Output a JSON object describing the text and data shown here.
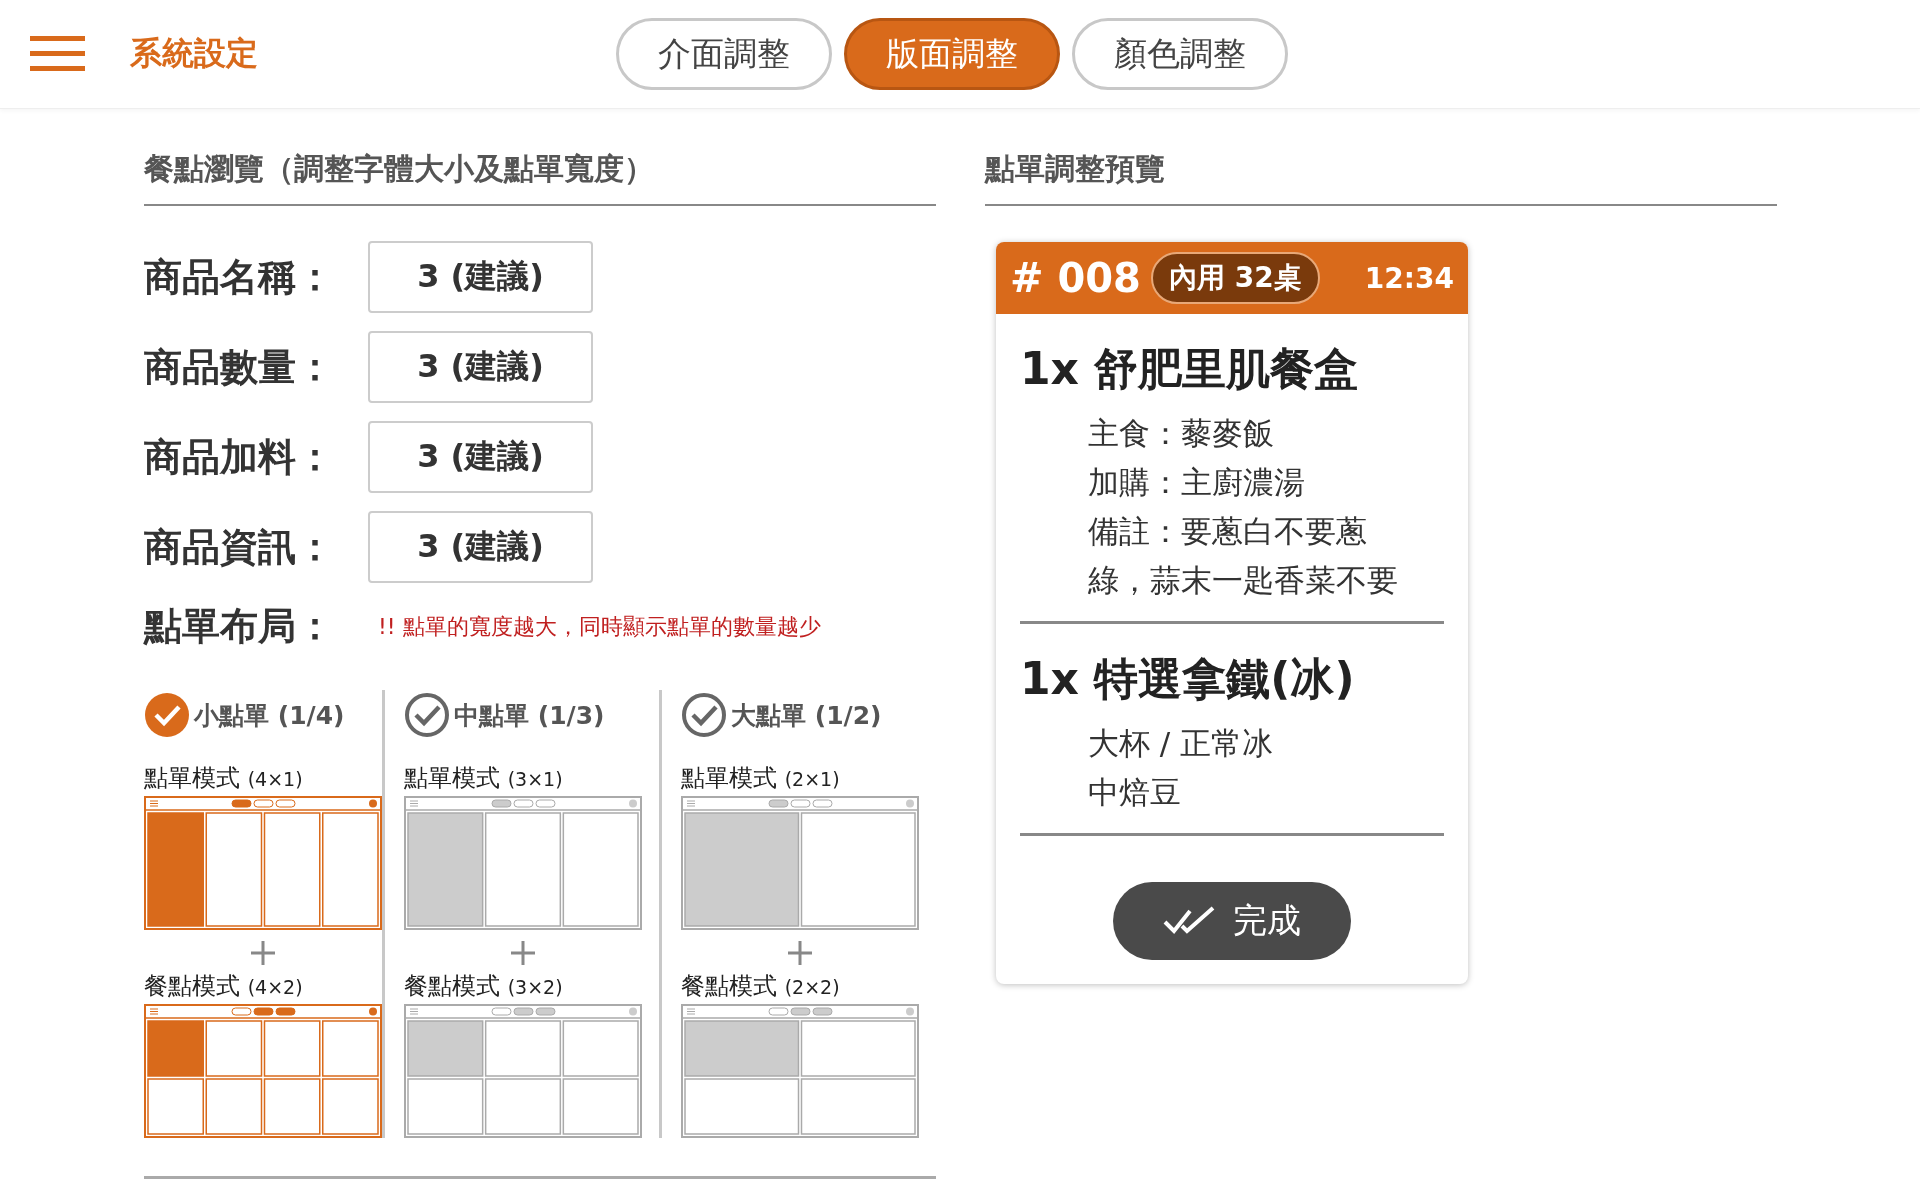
{
  "header": {
    "title": "系統設定",
    "tabs": [
      {
        "label": "介面調整",
        "selected": false
      },
      {
        "label": "版面調整",
        "selected": true
      },
      {
        "label": "顏色調整",
        "selected": false
      }
    ]
  },
  "settings": {
    "heading": "餐點瀏覽（調整字體大小及點單寬度）",
    "fields": [
      {
        "label": "商品名稱：",
        "value": "3 (建議)"
      },
      {
        "label": "商品數量：",
        "value": "3 (建議)"
      },
      {
        "label": "商品加料：",
        "value": "3 (建議)"
      },
      {
        "label": "商品資訊：",
        "value": "3 (建議)"
      }
    ],
    "layout": {
      "label": "點單布局：",
      "note": "!! 點單的寬度越大，同時顯示點單的數量越少",
      "options": [
        {
          "kind": "quarter",
          "label": "小點單 (1/4)",
          "selected": true,
          "order_mode": {
            "label": "點單模式",
            "grid": "(4×1)"
          },
          "meal_mode": {
            "label": "餐點模式",
            "grid": "(4×2)"
          }
        },
        {
          "kind": "third",
          "label": "中點單 (1/3)",
          "selected": false,
          "order_mode": {
            "label": "點單模式",
            "grid": "(3×1)"
          },
          "meal_mode": {
            "label": "餐點模式",
            "grid": "(3×2)"
          }
        },
        {
          "kind": "half",
          "label": "大點單 (1/2)",
          "selected": false,
          "order_mode": {
            "label": "點單模式",
            "grid": "(2×1)"
          },
          "meal_mode": {
            "label": "餐點模式",
            "grid": "(2×2)"
          }
        }
      ]
    }
  },
  "preview": {
    "heading": "點單調整預覽",
    "card": {
      "number": "# 008",
      "table": "內用 32桌",
      "time": "12:34",
      "items": [
        {
          "title": "1x 舒肥里肌餐盒",
          "details": [
            "主食：藜麥飯",
            "加購：主廚濃湯",
            "備註：要蔥白不要蔥綠，蒜末一匙香菜不要"
          ]
        },
        {
          "title": "1x 特選拿鐵(冰)",
          "details": [
            "大杯 / 正常冰",
            "中焙豆"
          ]
        }
      ],
      "button": "完成"
    }
  }
}
